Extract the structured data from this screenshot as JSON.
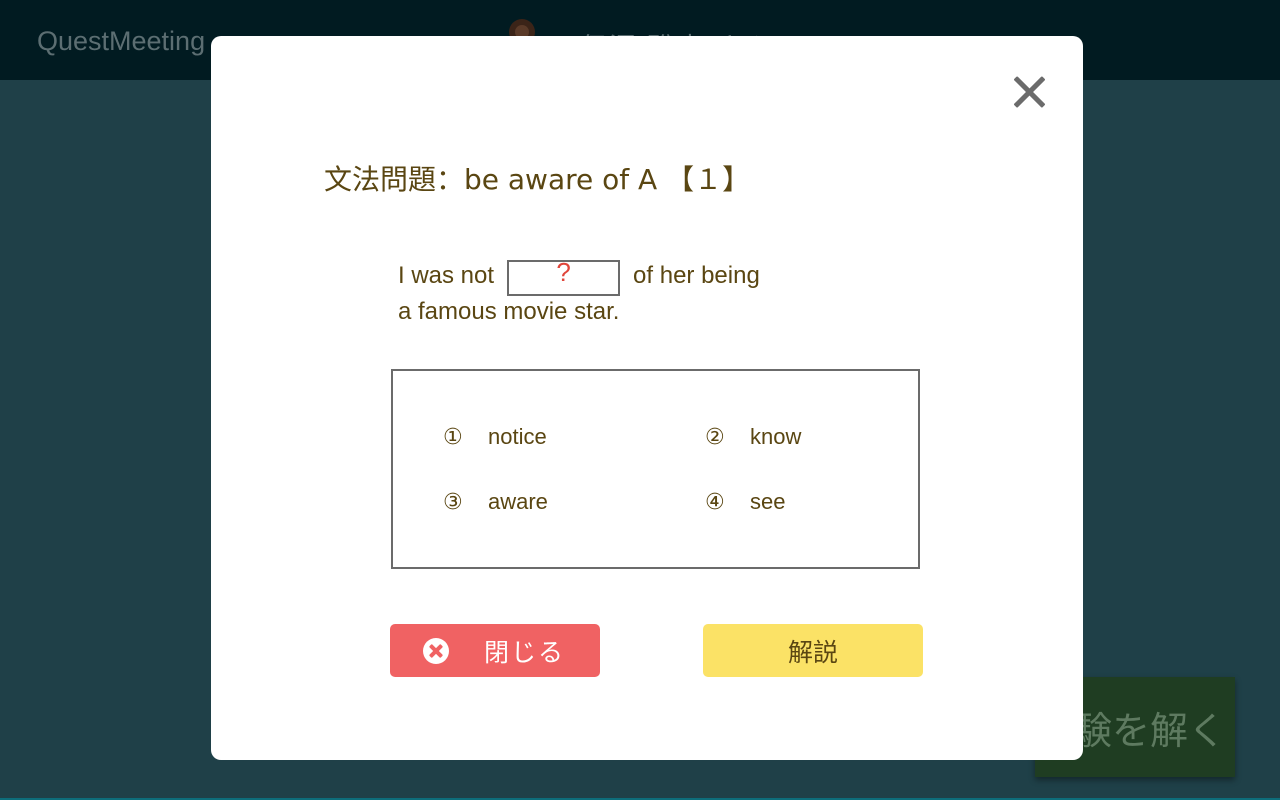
{
  "app": {
    "name": "QuestMeeting",
    "user_name": "伊澤 聡志 さん"
  },
  "background": {
    "solve_button_label": "験を解く"
  },
  "dialog": {
    "title": "文法問題：be aware of A 【１】",
    "sentence_before": "I was not",
    "blank_mark": "?",
    "sentence_after": "of her being",
    "sentence_line2": "a famous movie star.",
    "choices": [
      {
        "num": "①",
        "text": "notice"
      },
      {
        "num": "②",
        "text": "know"
      },
      {
        "num": "③",
        "text": "aware"
      },
      {
        "num": "④",
        "text": "see"
      }
    ],
    "close_label": "閉じる",
    "explain_label": "解説"
  },
  "colors": {
    "accent_red": "#f06263",
    "accent_yellow": "#fbe266",
    "text_brown": "#5a4612",
    "blank_red": "#e0453a"
  }
}
